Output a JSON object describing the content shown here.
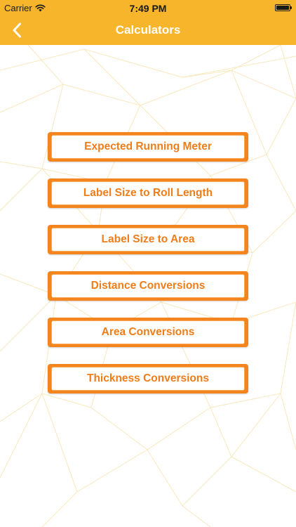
{
  "status_bar": {
    "carrier": "Carrier",
    "time": "7:49 PM",
    "wifi_icon": "wifi-icon",
    "battery_icon": "battery-icon"
  },
  "nav": {
    "title": "Calculators",
    "back_icon": "chevron-left-icon"
  },
  "menu": {
    "items": [
      {
        "label": "Expected Running Meter"
      },
      {
        "label": "Label Size to Roll Length"
      },
      {
        "label": "Label Size to Area"
      },
      {
        "label": "Distance Conversions"
      },
      {
        "label": "Area Conversions"
      },
      {
        "label": "Thickness Conversions"
      }
    ]
  },
  "colors": {
    "header": "#f7b52c",
    "button_border": "#f4841e",
    "button_text": "#ee7d1a",
    "pattern_line": "#f8e6b8"
  }
}
